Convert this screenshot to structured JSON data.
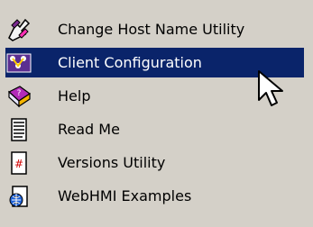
{
  "menu": {
    "items": [
      {
        "label": "Change Host Name Utility",
        "icon": "host-name-utility-icon",
        "selected": false
      },
      {
        "label": "Client Configuration",
        "icon": "client-configuration-icon",
        "selected": true
      },
      {
        "label": "Help",
        "icon": "help-book-icon",
        "selected": false
      },
      {
        "label": "Read Me",
        "icon": "text-document-icon",
        "selected": false
      },
      {
        "label": "Versions Utility",
        "icon": "versions-utility-icon",
        "selected": false
      },
      {
        "label": "WebHMI Examples",
        "icon": "web-page-icon",
        "selected": false
      }
    ],
    "highlight_color": "#0a246a",
    "background_color": "#d4d0c8"
  },
  "cursor": {
    "icon": "mouse-pointer-icon"
  }
}
